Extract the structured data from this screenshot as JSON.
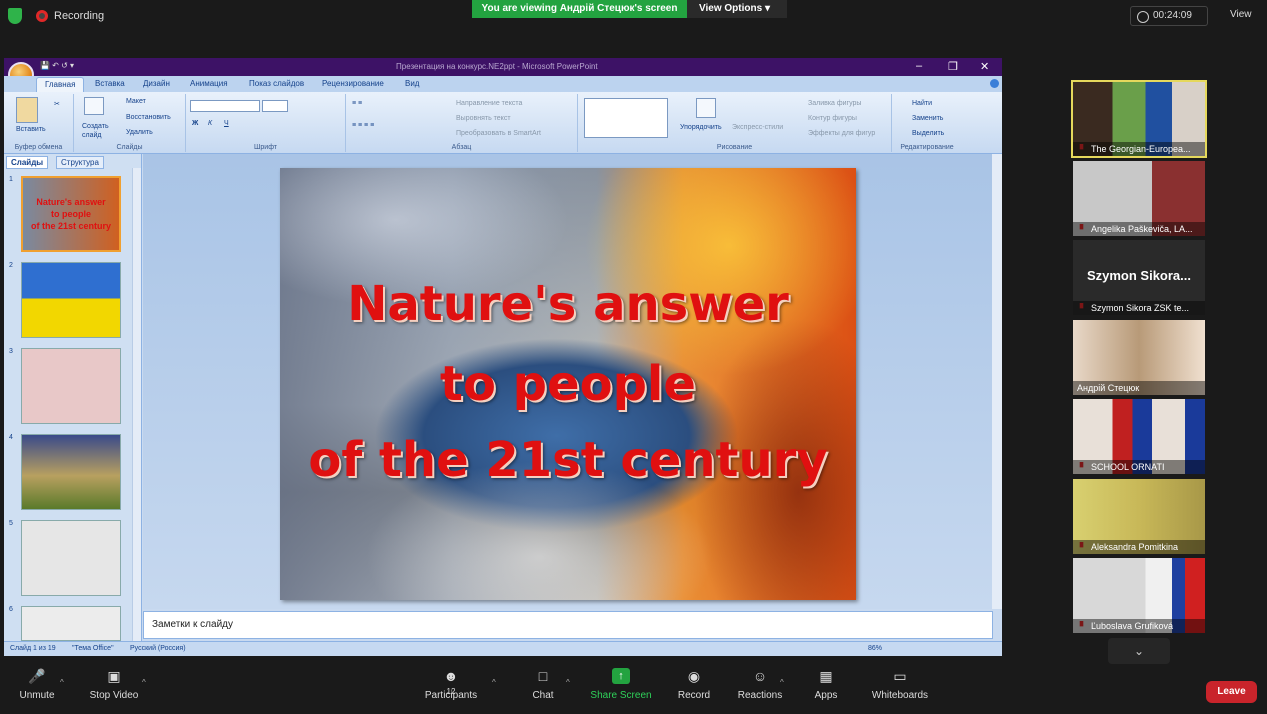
{
  "topbar": {
    "recording_label": "Recording",
    "viewing_banner": "You are viewing Андрій Стецюк's screen",
    "view_options": "View Options",
    "timer": "00:24:09",
    "view_label": "View"
  },
  "ppt": {
    "window_title": "Презентация на конкурс.NE2ppt - Microsoft PowerPoint",
    "tabs": [
      "Главная",
      "Вставка",
      "Дизайн",
      "Анимация",
      "Показ слайдов",
      "Рецензирование",
      "Вид"
    ],
    "ribbon": {
      "paste": "Вставить",
      "clipboard_group": "Буфер обмена",
      "new_slide": "Создать слайд",
      "layout": "Макет",
      "reset": "Восстановить",
      "delete": "Удалить",
      "slides_group": "Слайды",
      "font_group": "Шрифт",
      "text_direction": "Направление текста",
      "align_text": "Выровнять текст",
      "smartart": "Преобразовать в SmartArt",
      "paragraph_group": "Абзац",
      "arrange": "Упорядочить",
      "quick_styles": "Экспресс-стили",
      "shape_fill": "Заливка фигуры",
      "shape_outline": "Контур фигуры",
      "shape_effects": "Эффекты для фигур",
      "drawing_group": "Рисование",
      "find": "Найти",
      "replace": "Заменить",
      "select": "Выделить",
      "editing_group": "Редактирование"
    },
    "pane_tabs": [
      "Слайды",
      "Структура"
    ],
    "thumb_numbers": [
      "1",
      "2",
      "3",
      "4",
      "5",
      "6"
    ],
    "slide_title_lines": [
      "Nature's answer",
      "to people",
      "of the 21st century"
    ],
    "notes_placeholder": "Заметки к слайду",
    "status": {
      "slide_of": "Слайд 1 из 19",
      "theme": "\"Тема Office\"",
      "language": "Русский (Россия)",
      "zoom": "86%"
    }
  },
  "participants": [
    {
      "name": "The Georgian-Europea...",
      "active": true
    },
    {
      "name": "Angelika Paškeviča, LA..."
    },
    {
      "name": "Szymon Sikora ZSK te...",
      "big": "Szymon Sikora..."
    },
    {
      "name": "Андрій Стецюк"
    },
    {
      "name": "SCHOOL ORNATI"
    },
    {
      "name": "Aleksandra Pomitkina"
    },
    {
      "name": "Ľuboslava Grufiková"
    }
  ],
  "toolbar": {
    "unmute": "Unmute",
    "stop_video": "Stop Video",
    "participants": "Participants",
    "participants_count": "12",
    "chat": "Chat",
    "share_screen": "Share Screen",
    "record": "Record",
    "reactions": "Reactions",
    "apps": "Apps",
    "whiteboards": "Whiteboards",
    "leave": "Leave"
  },
  "colors": {
    "share_green": "#23a340",
    "leave_red": "#c9242b",
    "slide_title_red": "#e01010",
    "active_speaker_border": "#e5d85c"
  }
}
